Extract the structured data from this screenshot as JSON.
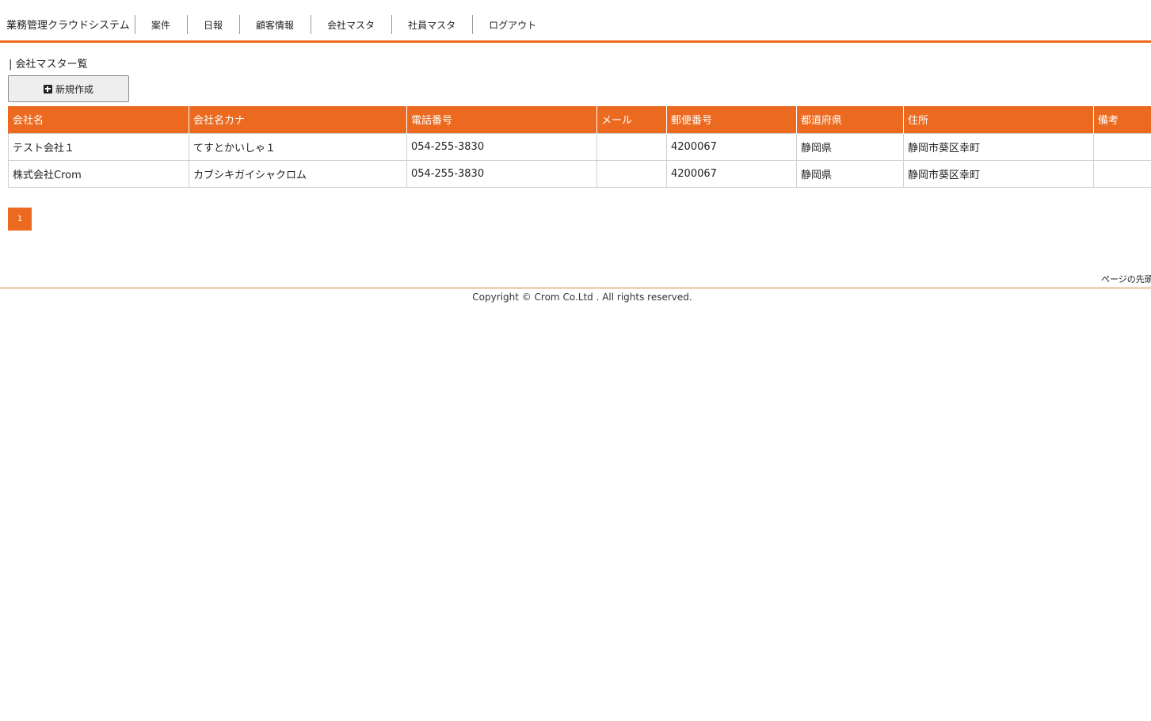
{
  "header": {
    "brand": "業務管理クラウドシステム",
    "nav": [
      {
        "label": "案件"
      },
      {
        "label": "日報"
      },
      {
        "label": "顧客情報"
      },
      {
        "label": "会社マスタ"
      },
      {
        "label": "社員マスタ"
      },
      {
        "label": "ログアウト"
      }
    ]
  },
  "main": {
    "section_title": "| 会社マスター覧",
    "new_button_label": "新規作成",
    "new_button_icon": "plus-square-icon",
    "table": {
      "columns": [
        "会社名",
        "会社名カナ",
        "電話番号",
        "メール",
        "郵便番号",
        "都道府県",
        "住所",
        "備考"
      ],
      "rows": [
        [
          "テスト会社１",
          "てすとかいしゃ１",
          "054-255-3830",
          "",
          "4200067",
          "静岡県",
          "静岡市葵区幸町",
          ""
        ],
        [
          "株式会社Crom",
          "カブシキガイシャクロム",
          "054-255-3830",
          "",
          "4200067",
          "静岡県",
          "静岡市葵区幸町",
          ""
        ]
      ]
    },
    "pager": {
      "current_page": "1"
    }
  },
  "footer": {
    "page_top": "ページの先頭",
    "copyright": "Copyright © Crom Co.Ltd . All rights reserved."
  },
  "colors": {
    "accent": "#ec6a1f",
    "footer_line": "#d4862a"
  }
}
